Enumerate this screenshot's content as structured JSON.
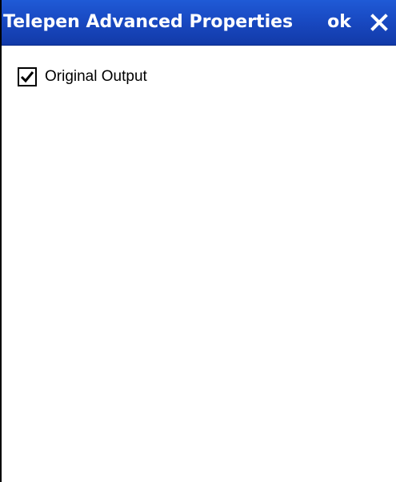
{
  "window": {
    "title": "Telepen Advanced Properties",
    "ok_label": "ok",
    "close_icon": "close-icon"
  },
  "options": {
    "original_output": {
      "label": "Original Output",
      "checked": true
    }
  },
  "colors": {
    "titlebar": "#1848c0",
    "background": "#ffffff",
    "text": "#000000"
  }
}
